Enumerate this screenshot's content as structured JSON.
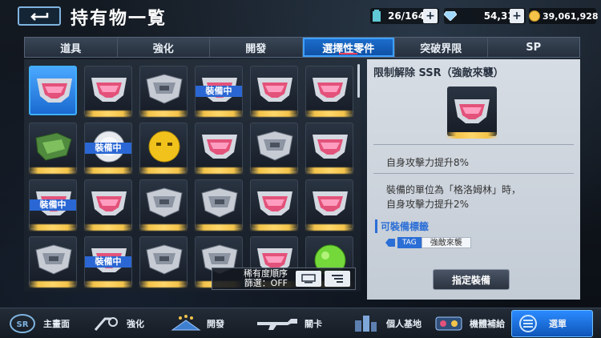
{
  "header": {
    "title": "持有物一覧",
    "capacity": "26/164",
    "gems": "54,310",
    "coins": "39,061,928"
  },
  "tabs": [
    {
      "label": "道具"
    },
    {
      "label": "強化"
    },
    {
      "label": "開發"
    },
    {
      "label": "選擇性零件"
    },
    {
      "label": "突破界限"
    },
    {
      "label": "SP"
    }
  ],
  "grid": {
    "equipped_label": "裝備中",
    "items": [
      {
        "kind": "pink",
        "selected": true,
        "equipped": false
      },
      {
        "kind": "pink",
        "selected": false,
        "equipped": false
      },
      {
        "kind": "armor",
        "selected": false,
        "equipped": false
      },
      {
        "kind": "pink",
        "selected": false,
        "equipped": true
      },
      {
        "kind": "pink",
        "selected": false,
        "equipped": false
      },
      {
        "kind": "pink",
        "selected": false,
        "equipped": false
      },
      {
        "kind": "green",
        "selected": false,
        "equipped": false
      },
      {
        "kind": "white",
        "selected": false,
        "equipped": true
      },
      {
        "kind": "yellow",
        "selected": false,
        "equipped": false
      },
      {
        "kind": "pink",
        "selected": false,
        "equipped": false
      },
      {
        "kind": "armor",
        "selected": false,
        "equipped": false
      },
      {
        "kind": "pink",
        "selected": false,
        "equipped": false
      },
      {
        "kind": "pink",
        "selected": false,
        "equipped": true
      },
      {
        "kind": "pink",
        "selected": false,
        "equipped": false
      },
      {
        "kind": "armor",
        "selected": false,
        "equipped": false
      },
      {
        "kind": "armor",
        "selected": false,
        "equipped": false
      },
      {
        "kind": "pink",
        "selected": false,
        "equipped": false
      },
      {
        "kind": "pink",
        "selected": false,
        "equipped": false
      },
      {
        "kind": "armor",
        "selected": false,
        "equipped": false
      },
      {
        "kind": "pink",
        "selected": false,
        "equipped": true
      },
      {
        "kind": "armor",
        "selected": false,
        "equipped": false
      },
      {
        "kind": "armor",
        "selected": false,
        "equipped": false
      },
      {
        "kind": "pink",
        "selected": false,
        "equipped": false
      },
      {
        "kind": "lime",
        "selected": false,
        "equipped": false
      }
    ]
  },
  "sort": {
    "order_label": "稀有度順序",
    "filter_label": "篩選：OFF"
  },
  "detail": {
    "title": "限制解除 SSR（強敵來襲）",
    "effect1": "自身攻擊力提升8%",
    "effect2_line1": "裝備的單位為「格洛姆林」時，",
    "effect2_line2": "自身攻擊力提升2%",
    "tags_heading": "可裝備標籤",
    "tag_pill": "TAG",
    "tag_name": "強敵來襲",
    "assign_button": "指定裝備"
  },
  "nav": [
    {
      "label": "主畫面",
      "icon": "home-emblem-icon"
    },
    {
      "label": "強化",
      "icon": "wrench-icon"
    },
    {
      "label": "開發",
      "icon": "blueprint-icon"
    },
    {
      "label": "關卡",
      "icon": "rifle-icon"
    },
    {
      "label": "個人基地",
      "icon": "base-icon"
    },
    {
      "label": "機體補給",
      "icon": "gacha-icon"
    },
    {
      "label": "選單",
      "icon": "menu-icon"
    }
  ]
}
